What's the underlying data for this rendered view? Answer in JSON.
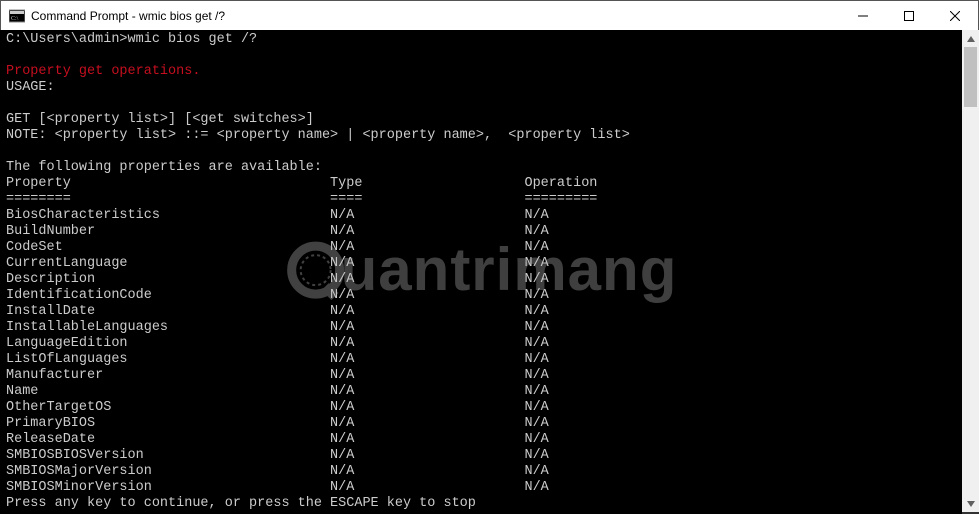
{
  "titlebar": {
    "title": "Command Prompt - wmic  bios get /?"
  },
  "terminal": {
    "prompt_path": "C:\\Users\\admin>",
    "command": "wmic bios get /?",
    "heading_line": "Property get operations.",
    "usage_label": "USAGE:",
    "get_syntax": "GET [<property list>] [<get switches>]",
    "note_line": "NOTE: <property list> ::= <property name> | <property name>,  <property list>",
    "available_line": "The following properties are available:",
    "columns": {
      "c1": "Property",
      "c2": "Type",
      "c3": "Operation"
    },
    "divider": {
      "c1": "========",
      "c2": "====",
      "c3": "========="
    },
    "rows": [
      {
        "c1": "BiosCharacteristics",
        "c2": "N/A",
        "c3": "N/A"
      },
      {
        "c1": "BuildNumber",
        "c2": "N/A",
        "c3": "N/A"
      },
      {
        "c1": "CodeSet",
        "c2": "N/A",
        "c3": "N/A"
      },
      {
        "c1": "CurrentLanguage",
        "c2": "N/A",
        "c3": "N/A"
      },
      {
        "c1": "Description",
        "c2": "N/A",
        "c3": "N/A"
      },
      {
        "c1": "IdentificationCode",
        "c2": "N/A",
        "c3": "N/A"
      },
      {
        "c1": "InstallDate",
        "c2": "N/A",
        "c3": "N/A"
      },
      {
        "c1": "InstallableLanguages",
        "c2": "N/A",
        "c3": "N/A"
      },
      {
        "c1": "LanguageEdition",
        "c2": "N/A",
        "c3": "N/A"
      },
      {
        "c1": "ListOfLanguages",
        "c2": "N/A",
        "c3": "N/A"
      },
      {
        "c1": "Manufacturer",
        "c2": "N/A",
        "c3": "N/A"
      },
      {
        "c1": "Name",
        "c2": "N/A",
        "c3": "N/A"
      },
      {
        "c1": "OtherTargetOS",
        "c2": "N/A",
        "c3": "N/A"
      },
      {
        "c1": "PrimaryBIOS",
        "c2": "N/A",
        "c3": "N/A"
      },
      {
        "c1": "ReleaseDate",
        "c2": "N/A",
        "c3": "N/A"
      },
      {
        "c1": "SMBIOSBIOSVersion",
        "c2": "N/A",
        "c3": "N/A"
      },
      {
        "c1": "SMBIOSMajorVersion",
        "c2": "N/A",
        "c3": "N/A"
      },
      {
        "c1": "SMBIOSMinorVersion",
        "c2": "N/A",
        "c3": "N/A"
      }
    ],
    "continue_prompt": "Press any key to continue, or press the ESCAPE key to stop"
  },
  "watermark": {
    "text": "uantrimang"
  }
}
